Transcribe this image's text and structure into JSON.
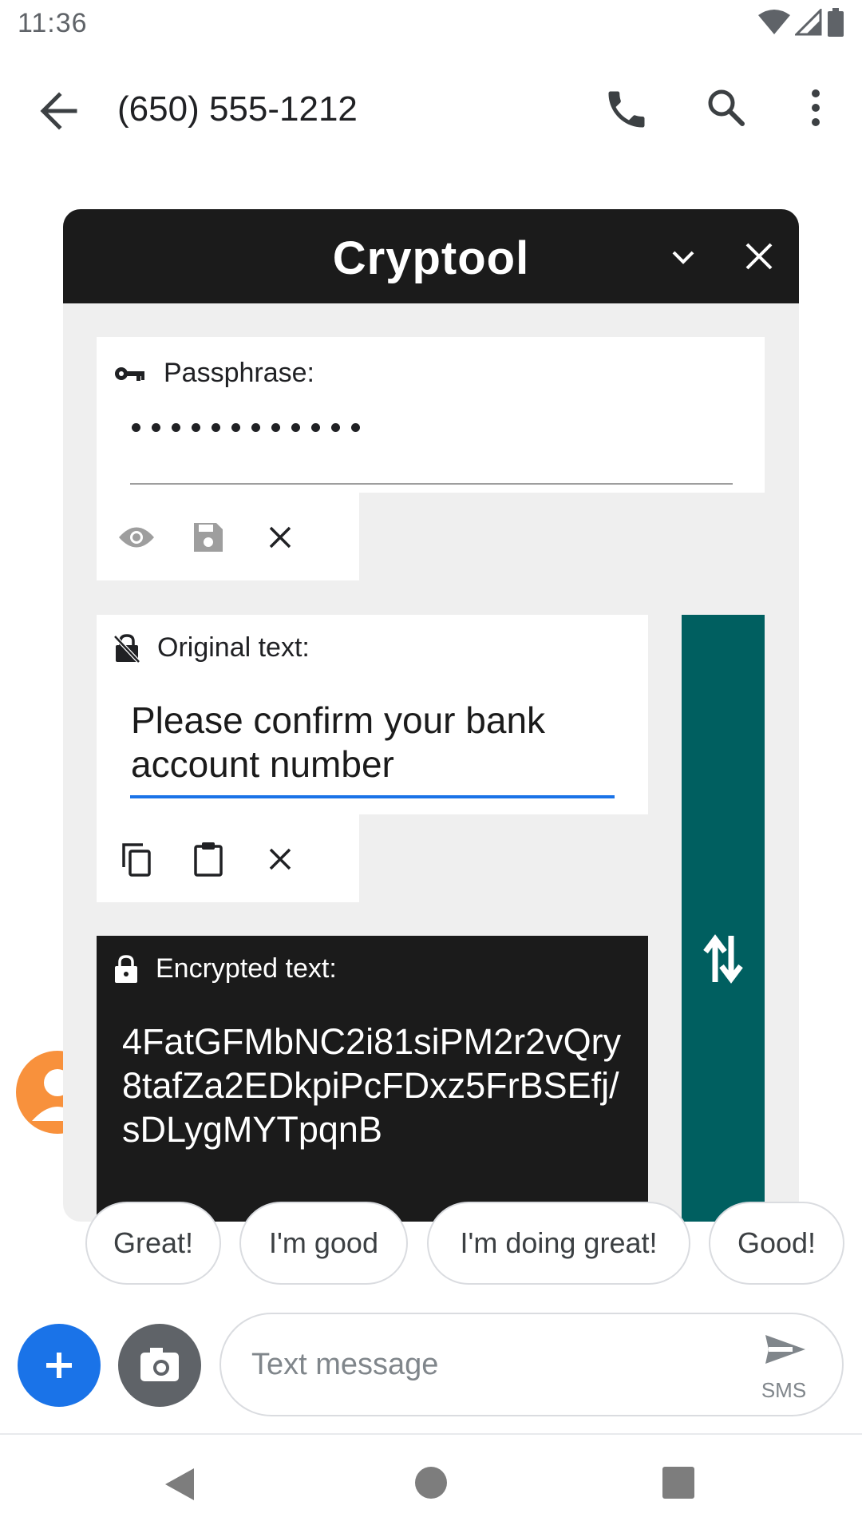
{
  "status_bar": {
    "time": "11:36"
  },
  "app_bar": {
    "title": "(650) 555-1212"
  },
  "cryptool": {
    "title": "Cryptool",
    "passphrase": {
      "label": "Passphrase:",
      "masked_length": 12
    },
    "original": {
      "label": "Original text:",
      "value": "Please confirm your bank account number"
    },
    "encrypted": {
      "label": "Encrypted text:",
      "value": "4FatGFMbNC2i81siPM2r2vQry8tafZa2EDkpiPcFDxz5FrBSEfj/sDLygMYTpqnB"
    }
  },
  "smart_replies": [
    "Great!",
    "I'm good",
    "I'm doing great!",
    "Good!"
  ],
  "compose": {
    "placeholder": "Text message",
    "send_label": "SMS"
  },
  "colors": {
    "header": "#1b1b1b",
    "swap_button": "#005f60",
    "accent": "#1a73e8",
    "avatar": "#f8913c"
  },
  "icons": [
    "wifi-icon",
    "signal-icon",
    "battery-icon",
    "back-arrow-icon",
    "phone-icon",
    "search-icon",
    "more-vert-icon",
    "chevron-down-icon",
    "close-icon",
    "key-icon",
    "eye-icon",
    "save-icon",
    "clear-icon",
    "lock-open-icon",
    "copy-icon",
    "paste-icon",
    "lock-icon",
    "swap-vert-icon",
    "plus-icon",
    "camera-icon",
    "send-icon"
  ]
}
